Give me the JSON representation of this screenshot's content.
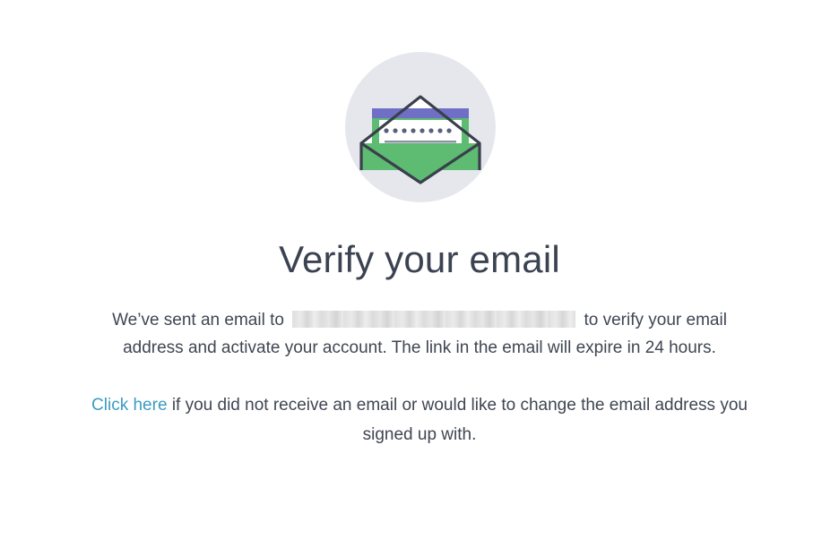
{
  "illustration": {
    "icon": "open-envelope-icon",
    "colors": {
      "circle": "#e6e7ec",
      "envelope_outline": "#3a3f4b",
      "letter_header": "#6f6fc6",
      "letter_body": "#5dbb72",
      "paper": "#ffffff",
      "dots": "#59607a"
    }
  },
  "heading": "Verify your email",
  "message": {
    "before_email": "We’ve sent an email to",
    "after_email": "to verify your email address and activate your account. The link in the email will expire in 24 hours."
  },
  "resend": {
    "link_label": "Click here",
    "rest": "if you did not receive an email or would like to change the email address you signed up with."
  },
  "colors": {
    "link": "#3b9cc1",
    "text": "#3f4652",
    "heading": "#3b4250"
  }
}
